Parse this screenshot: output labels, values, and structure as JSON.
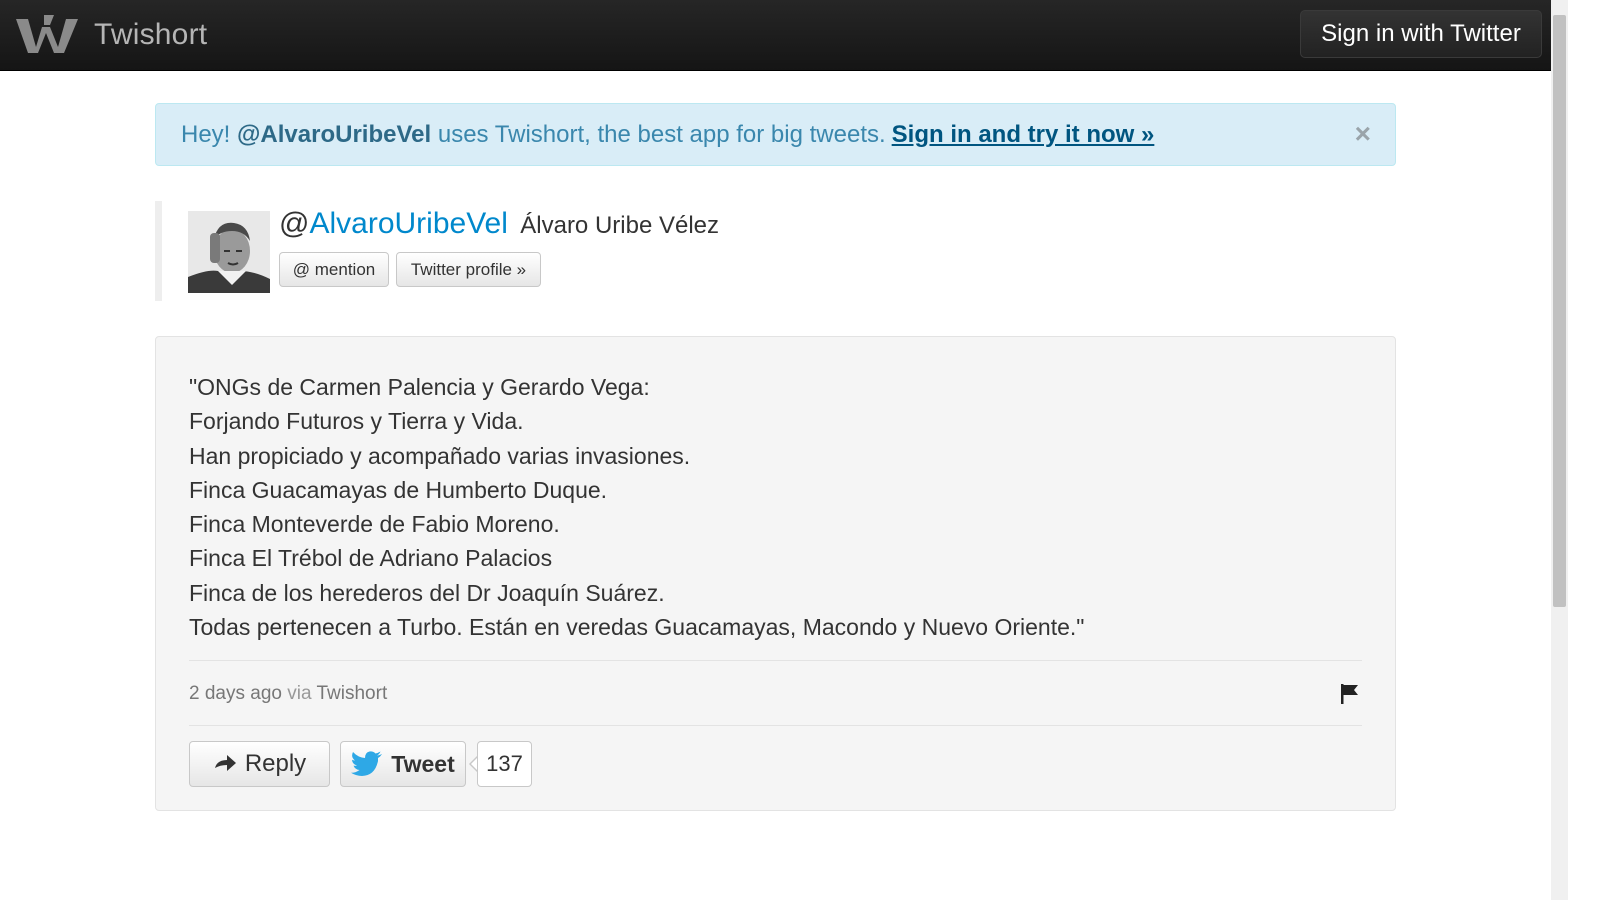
{
  "navbar": {
    "brand": "Twishort",
    "logo_icon": "twishort-logo-icon",
    "signin_label": "Sign in with Twitter"
  },
  "alert": {
    "prefix": "Hey!",
    "handle": "@AlvaroUribeVel",
    "message": "uses Twishort, the best app for big tweets.",
    "link_label": "Sign in and try it now »",
    "close_glyph": "×"
  },
  "profile": {
    "at": "@",
    "handle": "AlvaroUribeVel",
    "real_name": "Álvaro Uribe Vélez",
    "mention_label": "@ mention",
    "twitter_profile_label": "Twitter profile »"
  },
  "tweet": {
    "lines": [
      "\"ONGs de Carmen Palencia y Gerardo Vega:",
      "Forjando Futuros y Tierra y Vida.",
      "Han propiciado y acompañado varias invasiones.",
      "Finca Guacamayas de Humberto Duque.",
      "Finca Monteverde de Fabio Moreno.",
      "Finca El Trébol de Adriano Palacios",
      "Finca de los herederos del Dr Joaquín Suárez.",
      "Todas pertenecen a Turbo. Están en veredas Guacamayas, Macondo y Nuevo Oriente.\""
    ],
    "time": "2 days ago",
    "via_label": "via",
    "via_app": "Twishort",
    "reply_label": "Reply",
    "tweet_label": "Tweet",
    "tweet_count": "137"
  },
  "colors": {
    "link": "#0088cc",
    "alert_bg": "#d9edf7",
    "alert_text": "#3a87ad",
    "navbar_bg": "#1b1b1b",
    "twitter_blue": "#2ea8e6"
  }
}
